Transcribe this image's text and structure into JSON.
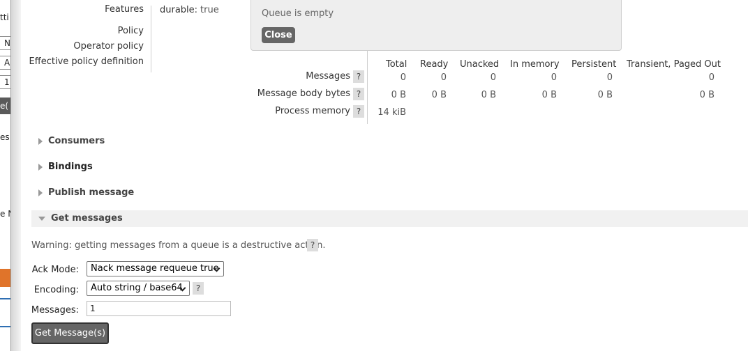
{
  "background_window": {
    "fragments": [
      "tti",
      "N",
      "A",
      "1",
      "e(",
      "es",
      "e N"
    ]
  },
  "details": {
    "features_label": "Features",
    "policy_label": "Policy",
    "operator_policy_label": "Operator policy",
    "effective_policy_label": "Effective policy definition",
    "durable_key": "durable:",
    "durable_value": "true"
  },
  "popup": {
    "message": "Queue is empty",
    "close_label": "Close"
  },
  "stats": {
    "headers": [
      "Total",
      "Ready",
      "Unacked",
      "In memory",
      "Persistent",
      "Transient, Paged Out"
    ],
    "rows": [
      {
        "label": "Messages",
        "help": "?",
        "values": [
          "0",
          "0",
          "0",
          "0",
          "0",
          "0"
        ]
      },
      {
        "label": "Message body bytes",
        "help": "?",
        "values": [
          "0 B",
          "0 B",
          "0 B",
          "0 B",
          "0 B",
          "0 B"
        ]
      },
      {
        "label": "Process memory",
        "help": "?",
        "values": [
          "14 kiB"
        ]
      }
    ]
  },
  "sections": {
    "consumers": "Consumers",
    "bindings": "Bindings",
    "publish": "Publish message",
    "get": "Get messages"
  },
  "get_messages": {
    "warning": "Warning: getting messages from a queue is a destructive action.",
    "warning_help": "?",
    "ack_mode_label": "Ack Mode:",
    "ack_mode_value": "Nack message requeue true",
    "encoding_label": "Encoding:",
    "encoding_value": "Auto string / base64",
    "encoding_help": "?",
    "messages_label": "Messages:",
    "messages_value": "1",
    "submit_label": "Get Message(s)"
  },
  "colors": {
    "button_bg": "#666666",
    "section_open_bg": "#f1f1f1",
    "popup_bg": "#eeeeee",
    "help_bg": "#dddddd"
  }
}
